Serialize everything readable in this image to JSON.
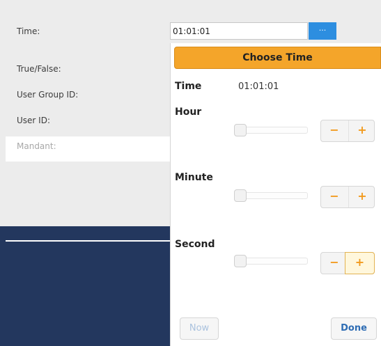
{
  "form": {
    "time_label": "Time:",
    "true_false_label": "True/False:",
    "user_group_label": "User Group ID:",
    "user_id_label": "User ID:",
    "mandant_label": "Mandant:",
    "time_value": "01:01:01",
    "picker_button_label": "..."
  },
  "picker": {
    "title": "Choose Time",
    "time_label": "Time",
    "time_value": "01:01:01",
    "hour_label": "Hour",
    "minute_label": "Minute",
    "second_label": "Second",
    "minus_label": "−",
    "plus_label": "+",
    "now_label": "Now",
    "done_label": "Done"
  },
  "colors": {
    "header_orange": "#f4a52a",
    "picker_button_blue": "#2d8ee0",
    "navy": "#23375e",
    "stepper_orange": "#f29a1d",
    "done_blue": "#2f6db4"
  }
}
